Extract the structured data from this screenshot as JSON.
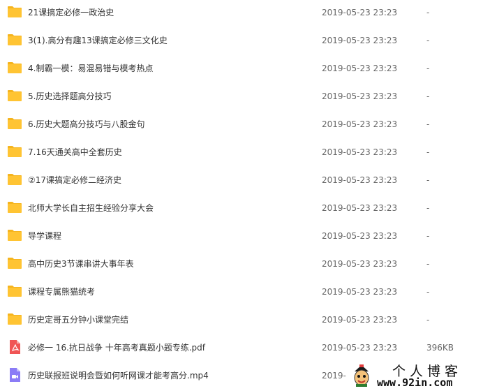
{
  "files": [
    {
      "name": "21课搞定必修一政治史",
      "date": "2019-05-23 23:23",
      "size": "-",
      "type": "folder"
    },
    {
      "name": "3(1).高分有趣13课搞定必修三文化史",
      "date": "2019-05-23 23:23",
      "size": "-",
      "type": "folder"
    },
    {
      "name": "4.制霸一模：易混易错与模考热点",
      "date": "2019-05-23 23:23",
      "size": "-",
      "type": "folder"
    },
    {
      "name": "5.历史选择题高分技巧",
      "date": "2019-05-23 23:23",
      "size": "-",
      "type": "folder"
    },
    {
      "name": "6.历史大题高分技巧与八股金句",
      "date": "2019-05-23 23:23",
      "size": "-",
      "type": "folder"
    },
    {
      "name": "7.16天通关高中全套历史",
      "date": "2019-05-23 23:23",
      "size": "-",
      "type": "folder"
    },
    {
      "name": "②17课搞定必修二经济史",
      "date": "2019-05-23 23:23",
      "size": "-",
      "type": "folder"
    },
    {
      "name": "北师大学长自主招生经验分享大会",
      "date": "2019-05-23 23:23",
      "size": "-",
      "type": "folder"
    },
    {
      "name": "导学课程",
      "date": "2019-05-23 23:23",
      "size": "-",
      "type": "folder"
    },
    {
      "name": "高中历史3节课串讲大事年表",
      "date": "2019-05-23 23:23",
      "size": "-",
      "type": "folder"
    },
    {
      "name": "课程专属熊猫统考",
      "date": "2019-05-23 23:23",
      "size": "-",
      "type": "folder"
    },
    {
      "name": "历史定哥五分钟小课堂完结",
      "date": "2019-05-23 23:23",
      "size": "-",
      "type": "folder"
    },
    {
      "name": "必修一 16.抗日战争 十年高考真题小题专练.pdf",
      "date": "2019-05-23 23:23",
      "size": "396KB",
      "type": "pdf"
    },
    {
      "name": "历史联报班说明会暨如何听网课才能考高分.mp4",
      "date": "2019-",
      "size": "",
      "type": "video"
    }
  ],
  "icons": {
    "folder": "folder-icon",
    "pdf": "pdf-file-icon",
    "video": "video-file-icon"
  },
  "colors": {
    "folder": "#FFC433",
    "folder_tab": "#F5B41E",
    "pdf": "#F05454",
    "video": "#8B7CF6"
  },
  "watermark": {
    "title": "个人博客",
    "url": "www.92in.com"
  }
}
